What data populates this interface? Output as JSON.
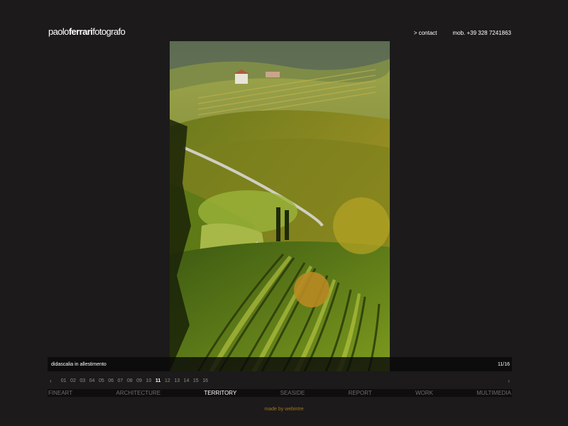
{
  "logo": {
    "part1": "paolo",
    "part2": "ferrari",
    "part3": "fotografo"
  },
  "top_links": {
    "contact": "> contact",
    "mobile": "mob. +39 328 7241863"
  },
  "photo": {
    "description": "vineyard-hills-photo"
  },
  "caption": {
    "text": "didascalia in allestimento",
    "counter": "11/16"
  },
  "pager": {
    "prev": "‹",
    "next": "›",
    "pages": [
      "01",
      "02",
      "03",
      "04",
      "05",
      "06",
      "07",
      "08",
      "09",
      "10",
      "11",
      "12",
      "13",
      "14",
      "15",
      "16"
    ],
    "active_index": 10
  },
  "nav": {
    "items": [
      "FINEART",
      "ARCHITECTURE",
      "TERRITORY",
      "SEASIDE",
      "REPORT",
      "WORK",
      "MULTIMEDIA"
    ],
    "active_index": 2
  },
  "footer": {
    "text": "made by webintre"
  },
  "colors": {
    "background": "#1c1a1b",
    "footer_accent": "#a0781a",
    "nav_inactive": "#6e6e6e"
  }
}
